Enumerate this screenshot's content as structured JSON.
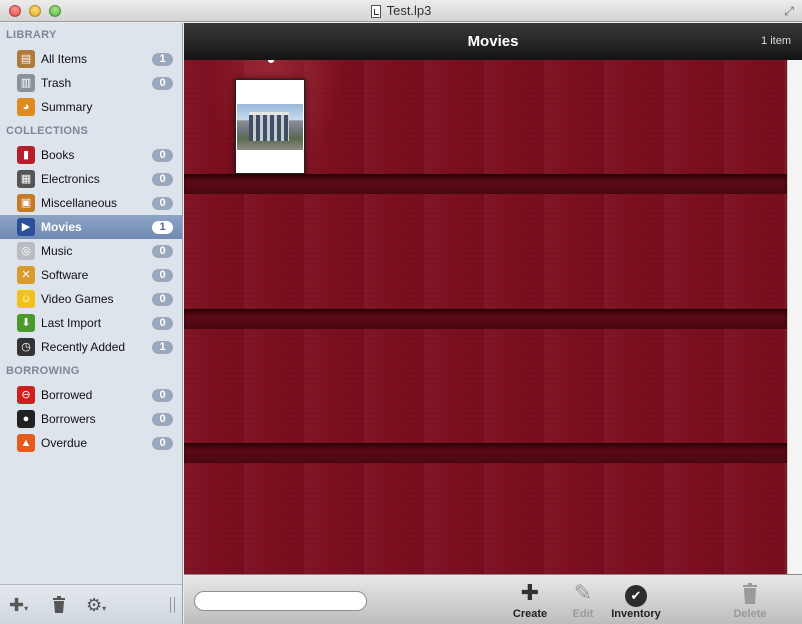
{
  "window": {
    "title": "Test.lp3"
  },
  "sidebar": {
    "sections": [
      {
        "header": "LIBRARY",
        "items": [
          {
            "label": "All Items",
            "count": "1",
            "icon": "bookshelf-icon",
            "color": "#b07a3a"
          },
          {
            "label": "Trash",
            "count": "0",
            "icon": "trash-can-icon",
            "color": "#8a939c"
          },
          {
            "label": "Summary",
            "count": "",
            "icon": "pie-chart-icon",
            "color": "#e08a1e"
          }
        ]
      },
      {
        "header": "COLLECTIONS",
        "items": [
          {
            "label": "Books",
            "count": "0",
            "icon": "book-icon",
            "color": "#b3202a"
          },
          {
            "label": "Electronics",
            "count": "0",
            "icon": "printer-icon",
            "color": "#555555"
          },
          {
            "label": "Miscellaneous",
            "count": "0",
            "icon": "box-icon",
            "color": "#c77a25"
          },
          {
            "label": "Movies",
            "count": "1",
            "icon": "clapperboard-icon",
            "color": "#2c4f9a",
            "selected": true
          },
          {
            "label": "Music",
            "count": "0",
            "icon": "cd-icon",
            "color": "#b9bcc0"
          },
          {
            "label": "Software",
            "count": "0",
            "icon": "tools-icon",
            "color": "#d99b2b"
          },
          {
            "label": "Video Games",
            "count": "0",
            "icon": "smiley-icon",
            "color": "#f2c21b"
          },
          {
            "label": "Last Import",
            "count": "0",
            "icon": "download-arrow-icon",
            "color": "#4a9a2a"
          },
          {
            "label": "Recently Added",
            "count": "1",
            "icon": "clock-icon",
            "color": "#333333"
          }
        ]
      },
      {
        "header": "BORROWING",
        "items": [
          {
            "label": "Borrowed",
            "count": "0",
            "icon": "no-entry-icon",
            "color": "#cf1f1f"
          },
          {
            "label": "Borrowers",
            "count": "0",
            "icon": "person-icon",
            "color": "#222222"
          },
          {
            "label": "Overdue",
            "count": "0",
            "icon": "calendar-alert-icon",
            "color": "#e65b1c"
          }
        ]
      }
    ]
  },
  "main": {
    "title": "Movies",
    "item_count": "1 item"
  },
  "toolbar": {
    "search_placeholder": "",
    "create_label": "Create",
    "edit_label": "Edit",
    "inventory_label": "Inventory",
    "delete_label": "Delete"
  },
  "colors": {
    "shelf_wood": "#7d0f1f",
    "selection": "#6f89b3",
    "header_dark": "#1c1c1c"
  }
}
